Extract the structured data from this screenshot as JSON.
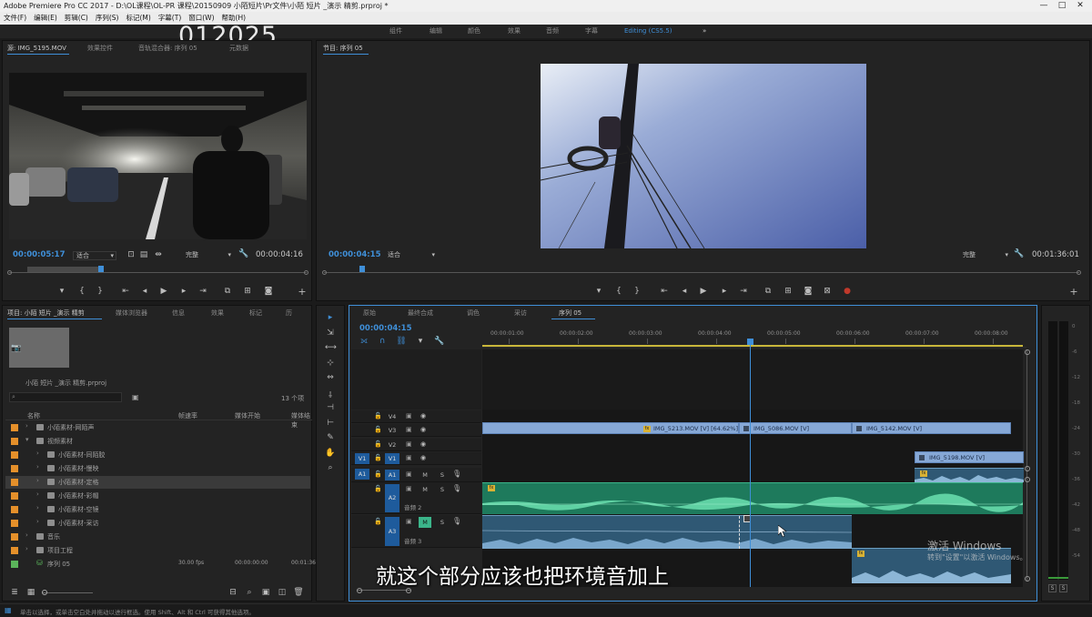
{
  "window": {
    "title": "Adobe Premiere Pro CC 2017 - D:\\OL课程\\OL-PR 课程\\20150909 小陌短片\\Pr文件\\小陌 短片 _演示 精剪.prproj *",
    "controls": [
      "—",
      "□",
      "✕"
    ]
  },
  "menu": [
    "文件(F)",
    "编辑(E)",
    "剪辑(C)",
    "序列(S)",
    "标记(M)",
    "字幕(T)",
    "窗口(W)",
    "帮助(H)"
  ],
  "workspaces": [
    "组件",
    "编辑",
    "颜色",
    "效果",
    "音频",
    "字幕",
    "Editing (CS5.5)",
    "»"
  ],
  "overlay_timecode": "012025",
  "source": {
    "tabs": [
      "源: IMG_5195.MOV",
      "效果控件",
      "音轨混合器: 序列 05",
      "元数据"
    ],
    "timecode_left": "00:00:05:17",
    "fit": "适合",
    "quality": "完整",
    "timecode_right": "00:00:04:16",
    "playhead_frac": 0.31,
    "inout_start_frac": 0.06,
    "inout_end_frac": 0.31
  },
  "program": {
    "tab": "节目: 序列 05",
    "timecode_left": "00:00:04:15",
    "fit": "适合",
    "quality": "完整",
    "timecode_right": "00:01:36:01",
    "playhead_frac": 0.05
  },
  "project": {
    "tabs": [
      "项目: 小陌 短片 _演示 精剪",
      "媒体浏览器",
      "信息",
      "效果",
      "标记",
      "历"
    ],
    "filename": "小陌 短片 _演示 精剪.prproj",
    "item_count": "13 个项",
    "columns": [
      "名称",
      "帧速率",
      "媒体开始",
      "媒体结束"
    ],
    "rows": [
      {
        "indent": 1,
        "name": "小陌素材-网陌声",
        "type": "folder",
        "color": "#e5902a"
      },
      {
        "indent": 1,
        "name": "视频素材",
        "type": "folder",
        "color": "#e5902a"
      },
      {
        "indent": 2,
        "name": "小陌素材-同陌胶",
        "type": "folder",
        "color": "#e5902a"
      },
      {
        "indent": 2,
        "name": "小陌素材-慢映",
        "type": "folder",
        "color": "#e5902a"
      },
      {
        "indent": 2,
        "name": "小陌素材-定格",
        "type": "folder",
        "color": "#e5902a",
        "selected": true
      },
      {
        "indent": 2,
        "name": "小陌素材-彩帽",
        "type": "folder",
        "color": "#e5902a"
      },
      {
        "indent": 2,
        "name": "小陌素材-空镜",
        "type": "folder",
        "color": "#e5902a"
      },
      {
        "indent": 2,
        "name": "小陌素材-采访",
        "type": "folder",
        "color": "#e5902a"
      },
      {
        "indent": 1,
        "name": "音乐",
        "type": "folder",
        "color": "#e5902a"
      },
      {
        "indent": 1,
        "name": "项目工程",
        "type": "folder",
        "color": "#e5902a"
      },
      {
        "indent": 1,
        "name": "序列 05",
        "type": "sequence",
        "color": "#5bb55b",
        "fps": "30.00 fps",
        "start": "00:00:00:00",
        "end": "00:01:36:01"
      }
    ]
  },
  "timeline": {
    "tabs": [
      "原始",
      "最终合成",
      "调色",
      "采访",
      "序列 05"
    ],
    "timecode": "00:00:04:15",
    "ruler": [
      "00:00:01:00",
      "00:00:02:00",
      "00:00:03:00",
      "00:00:04:00",
      "00:00:05:00",
      "00:00:06:00",
      "00:00:07:00",
      "00:00:08:00"
    ],
    "video_tracks": [
      "V4",
      "V3",
      "V2",
      "V1"
    ],
    "audio_tracks": [
      "A1",
      "A2",
      "A3"
    ],
    "audio_names": [
      "音频 2",
      "音频 3"
    ],
    "source_patch": [
      "V1",
      "A1"
    ],
    "clips": [
      {
        "label": "IMG_5213.MOV [V] [64.62%]"
      },
      {
        "label": "IMG_5086.MOV [V]"
      },
      {
        "label": "IMG_5142.MOV [V]"
      },
      {
        "label": "IMG_5198.MOV [V]"
      }
    ],
    "mute_solo": [
      "M",
      "S"
    ]
  },
  "subtitle": "就这个部分应该也把环境音加上",
  "activate": {
    "title": "激活 Windows",
    "body": "转到\"设置\"以激活 Windows。"
  },
  "meter_labels": [
    "S",
    "S"
  ],
  "meter_scale": [
    "0",
    "-6",
    "-12",
    "-18",
    "-24",
    "-30",
    "-36",
    "-42",
    "-48",
    "-54"
  ],
  "statusbar": "单击以选择，或单击空白处并拖动以进行框选。使用 Shift、Alt 和 Ctrl 可获得其他选项。"
}
